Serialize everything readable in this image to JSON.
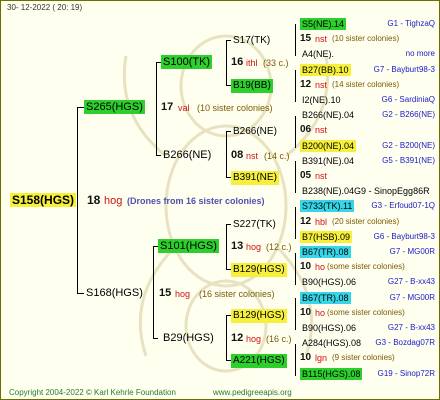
{
  "header_date": "30- 12-2022 ( 20: 19)",
  "footer": {
    "copyright": "Copyright 2004-2022 © Karl Kehrle Foundation",
    "site": "www.pedigreeapis.org"
  },
  "colors": {
    "green": "#2ccf2c",
    "yellow": "#f7f03a",
    "cyan": "#36d6e8",
    "blue": "#1a1ac8",
    "red": "#d01010"
  },
  "root": {
    "name": "S158(HGS)",
    "num": "18",
    "hog": "hog",
    "note": "(Drones from 16 sister colonies)"
  },
  "n": {
    "s265": {
      "name": "S265(HGS)",
      "num": "17",
      "tag": "val",
      "note": "(10 sister colonies)"
    },
    "s168": {
      "name": "S168(HGS)",
      "num": "15",
      "tag": "hog",
      "note": "(16 sister colonies)"
    },
    "s100": {
      "name": "S100(TK)",
      "num": "16",
      "tag": "ithl",
      "note": "(33 c.)"
    },
    "b266ne": {
      "name": "B266(NE)",
      "num": "08",
      "tag": "nst",
      "note": "(14 c.)"
    },
    "s101": {
      "name": "S101(HGS)",
      "num": "13",
      "tag": "hog",
      "note": "(12 c.)"
    },
    "b29": {
      "name": "B29(HGS)",
      "num": "12",
      "tag": "hog",
      "note": "(16 c.)"
    }
  },
  "g": {
    "s17tk": "S17(TK)",
    "b19bb": "B19(BB)",
    "b266": "B266(NE)",
    "b391": "B391(NE)",
    "s227": "S227(TK)",
    "b129": "B129(HGS)",
    "b129b": "B129(HGS)",
    "a221": "A221(HGS)"
  },
  "rows": [
    {
      "a": "S5(NE).14",
      "ac": "g",
      "b": "G1 - TighzaQ"
    },
    {
      "n": "15",
      "t": "nst",
      "note": "(10 sister colonies)"
    },
    {
      "a": "A4(NE).",
      "b": "no more"
    },
    {
      "a": "B27(BB).10",
      "ac": "y",
      "b": "G7 - Bayburt98-3"
    },
    {
      "n": "12",
      "t": "nst",
      "note": "(14 sister colonies)"
    },
    {
      "a": "I2(NE).10",
      "b": "G6 - SardiniaQ"
    },
    {
      "a": "B266(NE).04",
      "b": "G2 - B266(NE)"
    },
    {
      "n": "06",
      "t": "nst",
      "note": ""
    },
    {
      "a": "B200(NE).04",
      "ac": "y",
      "b": "G2 - B200(NE)"
    },
    {
      "a": "B391(NE).04",
      "b": "G5 - B391(NE)"
    },
    {
      "n": "05",
      "t": "nst",
      "note": ""
    },
    {
      "a": "B238(NE).04G9 - SinopEgg86R",
      "b": ""
    },
    {
      "a": "S733(TK).11",
      "ac": "c",
      "b": "G3 - Erfoud07-1Q"
    },
    {
      "n": "12",
      "t": "hbl",
      "note": "(20 sister colonies)"
    },
    {
      "a": "B7(HSB).09",
      "ac": "y",
      "b": "G6 - Bayburt98-3"
    },
    {
      "a": "B67(TR).08",
      "ac": "c",
      "b": "G7 - MG00R"
    },
    {
      "n": "10",
      "t": "ho",
      "note": "(some sister colonies)"
    },
    {
      "a": "B90(HGS).06",
      "b": "G27 - B-xx43"
    },
    {
      "a": "B67(TR).08",
      "ac": "c",
      "b": "G7 - MG00R"
    },
    {
      "n": "10",
      "t": "ho",
      "note": "(some sister colonies)"
    },
    {
      "a": "B90(HGS).06",
      "b": "G27 - B-xx43"
    },
    {
      "a": "A284(HGS).08",
      "b": "G3 - Bozdag07R"
    },
    {
      "n": "10",
      "t": "lgn",
      "note": "(9 sister colonies)"
    },
    {
      "a": "B115(HGS).08",
      "ac": "g",
      "b": "G19 - Sinop72R"
    }
  ]
}
